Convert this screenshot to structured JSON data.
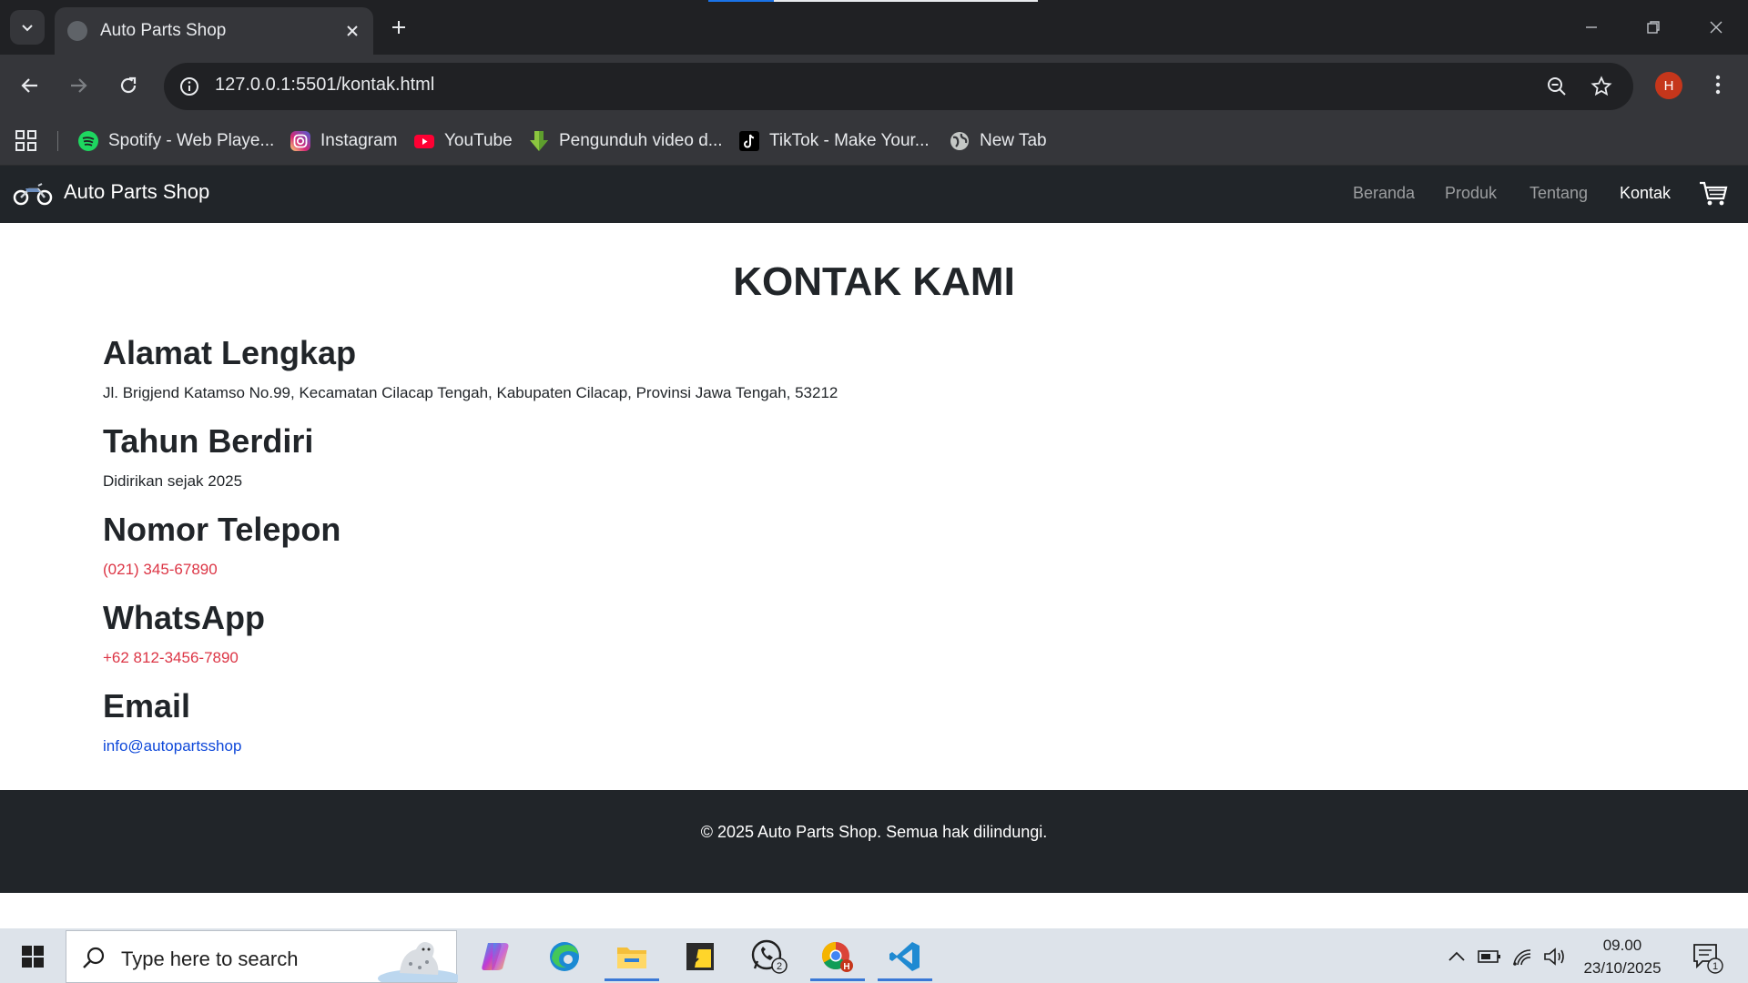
{
  "browser": {
    "tab_title": "Auto Parts Shop",
    "url": "127.0.0.1:5501/kontak.html",
    "profile_initial": "H",
    "bookmarks": [
      {
        "label": "Spotify - Web Playe...",
        "icon": "spotify-icon"
      },
      {
        "label": "Instagram",
        "icon": "instagram-icon"
      },
      {
        "label": "YouTube",
        "icon": "youtube-icon"
      },
      {
        "label": "Pengunduh video d...",
        "icon": "download-arrow-icon"
      },
      {
        "label": "TikTok - Make Your...",
        "icon": "tiktok-icon"
      },
      {
        "label": "New Tab",
        "icon": "globe-icon"
      }
    ]
  },
  "site": {
    "brand": "Auto Parts Shop",
    "nav": [
      {
        "label": "Beranda",
        "active": false
      },
      {
        "label": "Produk",
        "active": false
      },
      {
        "label": "Tentang",
        "active": false
      },
      {
        "label": "Kontak",
        "active": true
      }
    ],
    "page_title": "KONTAK KAMI",
    "sections": {
      "address": {
        "heading": "Alamat Lengkap",
        "text": "Jl. Brigjend Katamso No.99, Kecamatan Cilacap Tengah, Kabupaten Cilacap, Provinsi Jawa Tengah, 53212"
      },
      "founded": {
        "heading": "Tahun Berdiri",
        "text": "Didirikan sejak 2025"
      },
      "phone": {
        "heading": "Nomor Telepon",
        "text": "(021) 345-67890"
      },
      "whatsapp": {
        "heading": "WhatsApp",
        "text": "+62 812-3456-7890"
      },
      "email": {
        "heading": "Email",
        "text": "info@autopartsshop"
      }
    },
    "footer": "© 2025 Auto Parts Shop. Semua hak dilindungi."
  },
  "taskbar": {
    "search_placeholder": "Type here to search",
    "apps": [
      "copilot-icon",
      "edge-icon",
      "file-explorer-icon",
      "sticky-notes-icon",
      "whatsapp-icon",
      "chrome-icon",
      "vscode-icon"
    ],
    "whatsapp_badge": "2",
    "time": "09.00",
    "date": "23/10/2025",
    "notification_count": "1"
  },
  "colors": {
    "navbar": "#212529",
    "link_red": "#dc3545",
    "link_blue": "#0d47d9",
    "chrome_dark": "#202124"
  }
}
